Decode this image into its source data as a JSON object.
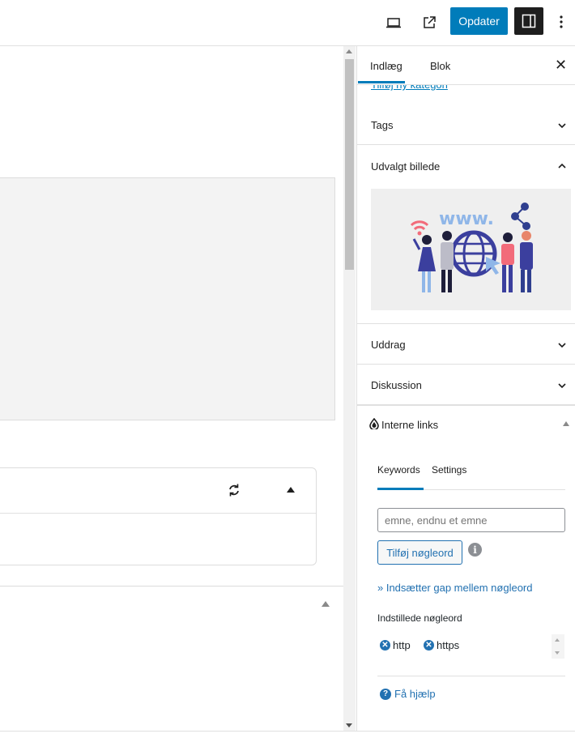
{
  "toolbar": {
    "preview_icon": "laptop-icon",
    "external_icon": "external-link-icon",
    "update_label": "Opdater",
    "sidebar_toggle_icon": "sidebar-icon",
    "more_icon": "more-vertical-icon",
    "accent_color": "#007cba"
  },
  "sidebar": {
    "tabs": [
      {
        "label": "Indlæg",
        "active": true
      },
      {
        "label": "Blok",
        "active": false
      }
    ],
    "close_icon": "close-icon",
    "peek_link": "Tilføj ny kategori",
    "sections": {
      "tags": "Tags",
      "featured_image": "Udvalgt billede",
      "excerpt": "Uddrag",
      "discussion": "Diskussion"
    },
    "featured_image_text": "www.",
    "internal_links": {
      "title": "Interne links",
      "tabs": [
        {
          "label": "Keywords",
          "active": true
        },
        {
          "label": "Settings",
          "active": false
        }
      ],
      "input_placeholder": "emne, endnu et emne",
      "add_button": "Tilføj nøgleord",
      "gap_link": "» Indsætter gap mellem nøgleord",
      "set_keywords_label": "Indstillede nøgleord",
      "keywords": [
        "http",
        "https"
      ],
      "help_link": "Få hjælp"
    }
  }
}
